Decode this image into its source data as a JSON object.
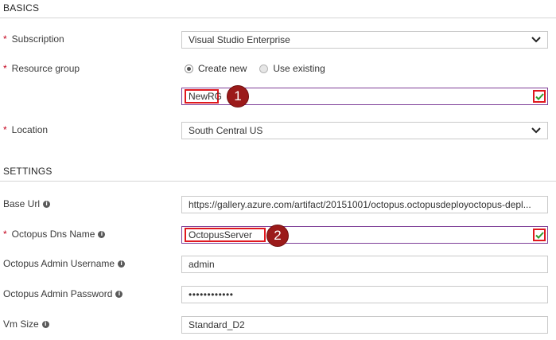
{
  "basics": {
    "title": "BASICS",
    "subscription": {
      "label": "Subscription",
      "value": "Visual Studio Enterprise"
    },
    "resource_group": {
      "label": "Resource group",
      "option_new": "Create new",
      "option_existing": "Use existing",
      "selected": "Create new",
      "value": "NewRG",
      "callout": "1"
    },
    "location": {
      "label": "Location",
      "value": "South Central US"
    }
  },
  "settings": {
    "title": "SETTINGS",
    "base_url": {
      "label": "Base Url",
      "value": "https://gallery.azure.com/artifact/20151001/octopus.octopusdeployoctopus-depl..."
    },
    "dns_name": {
      "label": "Octopus Dns Name",
      "value": "OctopusServer",
      "callout": "2"
    },
    "admin_username": {
      "label": "Octopus Admin Username",
      "value": "admin"
    },
    "admin_password": {
      "label": "Octopus Admin Password",
      "value": "••••••••••••"
    },
    "vm_size": {
      "label": "Vm Size",
      "value": "Standard_D2"
    }
  },
  "colors": {
    "required": "#c3001b",
    "valid_border": "#7f3f98",
    "highlight": "#e0181e",
    "callout": "#9b1a1a",
    "check": "#2e9e2e"
  },
  "icons": {
    "dropdown": "chevron-down-icon",
    "info": "info-icon",
    "valid": "checkmark-icon"
  }
}
